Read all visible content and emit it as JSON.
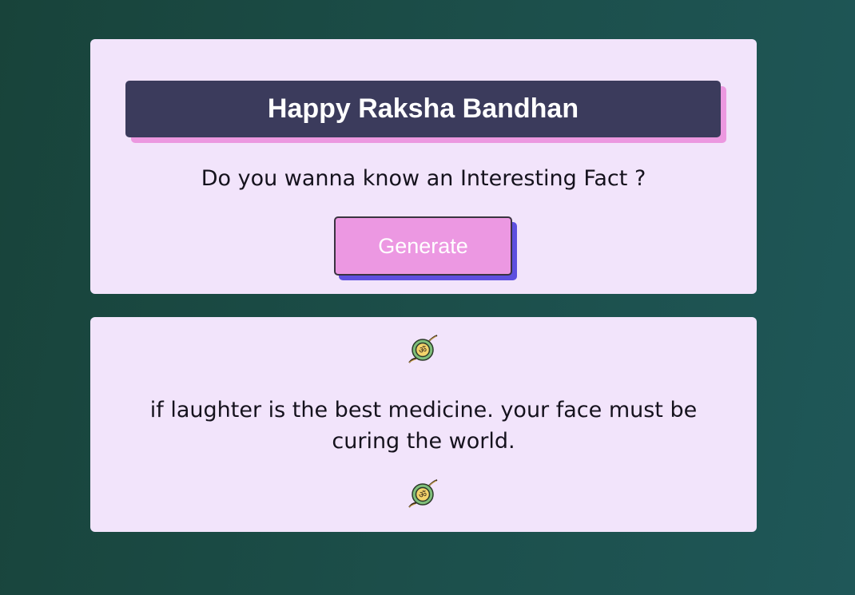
{
  "header": {
    "title": "Happy Raksha Bandhan"
  },
  "prompt": {
    "question": "Do you wanna know an Interesting Fact ?",
    "generate_label": "Generate"
  },
  "fact_card": {
    "top_icon": "rakhi-icon",
    "fact_text": "if laughter is the best medicine. your face must be curing the world.",
    "bottom_icon": "rakhi-icon"
  },
  "colors": {
    "background": "#18433a",
    "card": "#f2e4fb",
    "title_bar": "#3b3b5c",
    "title_shadow": "#ec98e0",
    "button": "#ec98e2",
    "button_shadow": "#5d4fdf"
  }
}
